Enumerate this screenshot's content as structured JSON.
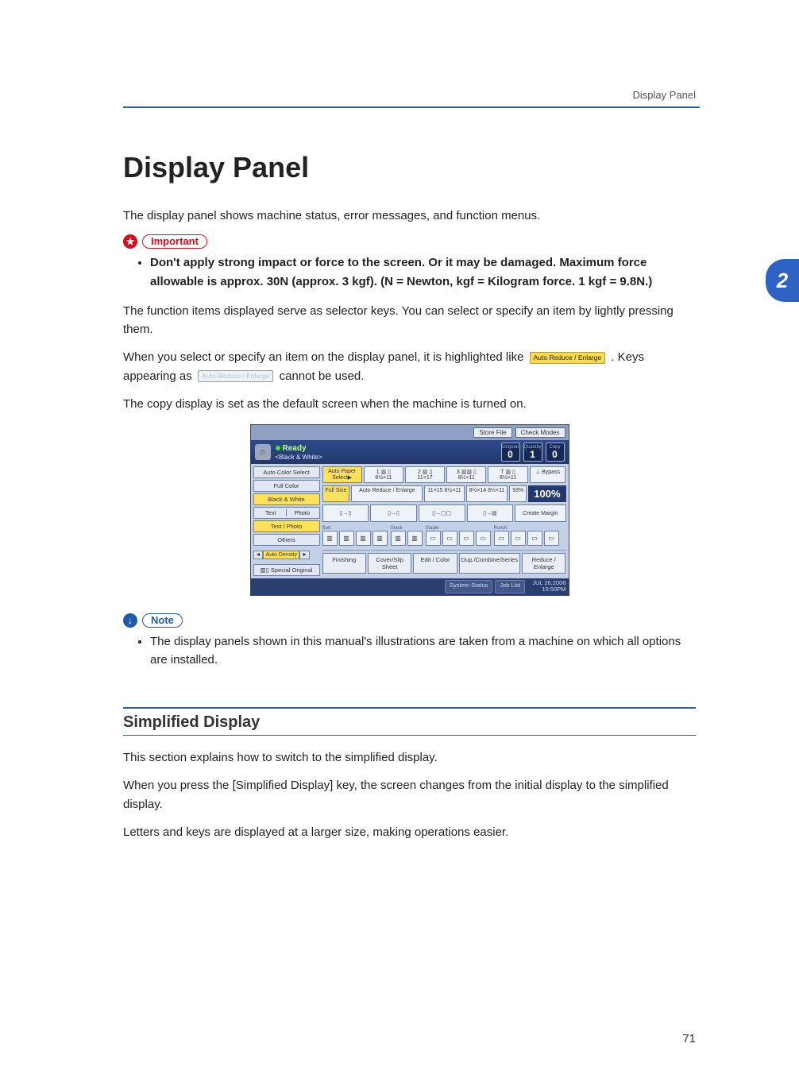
{
  "header": {
    "topic": "Display Panel"
  },
  "chapter_tab": "2",
  "title": "Display Panel",
  "intro": "The display panel shows machine status, error messages, and function menus.",
  "important": {
    "label": "Important",
    "items": [
      "Don't apply strong impact or force to the screen. Or it may be damaged. Maximum force allowable is approx. 30N (approx. 3 kgf). (N = Newton, kgf = Kilogram force. 1 kgf = 9.8N.)"
    ]
  },
  "body_para_1": "The function items displayed serve as selector keys. You can select or specify an item by lightly pressing them.",
  "body_para_2a": "When you select or specify an item on the display panel, it is highlighted like ",
  "body_para_2_key_active": "Auto Reduce / Enlarge",
  "body_para_2b": ". Keys appearing as ",
  "body_para_2_key_dimmed": "Auto Reduce / Enlarge",
  "body_para_2c": " cannot be used.",
  "body_para_3": "The copy display is set as the default screen when the machine is turned on.",
  "note": {
    "label": "Note",
    "items": [
      "The display panels shown in this manual's illustrations are taken from a machine on which all options are installed."
    ]
  },
  "section": {
    "title": "Simplified Display",
    "p1": "This section explains how to switch to the simplified display.",
    "p2": "When you press the [Simplified Display] key, the screen changes from the initial display to the simplified display.",
    "p3": "Letters and keys are displayed at a larger size, making operations easier."
  },
  "screen": {
    "top_buttons": {
      "store_file": "Store File",
      "check_modes": "Check Modes"
    },
    "ready": "Ready",
    "ready_sub": "<Black & White>",
    "counters": {
      "original_label": "Original",
      "original": "0",
      "quantity_label": "Quantity",
      "quantity": "1",
      "copy_label": "Copy",
      "copy": "0"
    },
    "mode_col": {
      "auto_color": "Auto Color Select",
      "full_color": "Full Color",
      "bw": "Black & White",
      "text": "Text",
      "photo": "Photo",
      "text_photo": "Text / Photo",
      "others": "Others"
    },
    "paper_col": {
      "auto_paper": "Auto Paper Select▶",
      "tray1_label": "1 ▥ ▯",
      "tray1_size": "8½×11",
      "tray2_label": "2 ▥ ▯",
      "tray2_size": "11×17",
      "tray3_label": "3 ▥▥ ▯",
      "tray3_size": "8½×11",
      "trayT_label": "T ▥ ▯",
      "trayT_size": "8½×11",
      "bypass": "⊥ Bypass"
    },
    "size_row": {
      "full_size": "Full Size",
      "auto_re": "Auto Reduce / Enlarge",
      "s1": "11×15 8½×11",
      "s2": "8½×14 8½×11",
      "pct93": "93%",
      "pct100": "100%"
    },
    "combine_row": {
      "c1": "▯→▯",
      "c2": "▯→▯",
      "c3": "▯→▢▢",
      "c4": "▯→▤",
      "create_margin": "Create Margin"
    },
    "density": {
      "left": "◄",
      "label": "Auto Density",
      "right": "►"
    },
    "sort_group": "Sort",
    "stack_group": "Stack",
    "staple_group": "Staple",
    "punch_group": "Punch",
    "special": "▥▯ Special Original",
    "bottom": {
      "finishing": "Finishing",
      "cover": "Cover/Slip Sheet",
      "edit": "Edit / Color",
      "dup": "Dup./Combine/Series",
      "reduce": "Reduce / Enlarge"
    },
    "status": {
      "system": "System Status",
      "job": "Job List",
      "date": "JUL 26,2006",
      "time": "10:50PM"
    }
  },
  "page_number": "71"
}
